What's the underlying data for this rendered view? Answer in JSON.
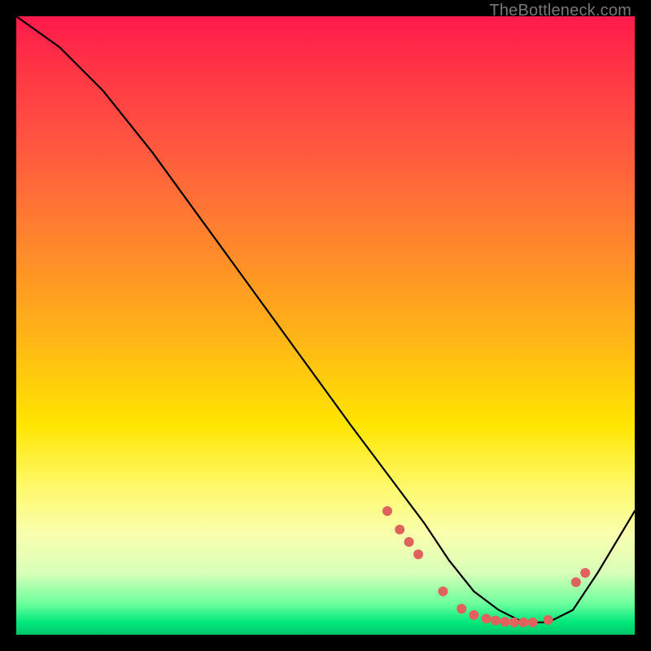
{
  "watermark": "TheBottleneck.com",
  "chart_data": {
    "type": "line",
    "title": "",
    "xlabel": "",
    "ylabel": "",
    "xlim": [
      0,
      100
    ],
    "ylim": [
      0,
      100
    ],
    "series": [
      {
        "name": "curve",
        "x": [
          0,
          7,
          14,
          22,
          30,
          38,
          46,
          54,
          60,
          66,
          70,
          74,
          78,
          82,
          86,
          90,
          94,
          100
        ],
        "y": [
          100,
          95,
          88,
          78,
          67,
          56,
          45,
          34,
          26,
          18,
          12,
          7,
          4,
          2,
          2,
          4,
          10,
          20
        ]
      }
    ],
    "markers": {
      "name": "samples",
      "color": "#e0625c",
      "x": [
        60,
        62,
        63.5,
        65,
        69,
        72,
        74,
        76,
        77.5,
        79,
        80.5,
        82,
        83.5,
        86,
        90.5,
        92
      ],
      "y": [
        20,
        17,
        15,
        13,
        7,
        4.2,
        3.2,
        2.6,
        2.3,
        2.1,
        2.0,
        2.0,
        2.0,
        2.4,
        8.5,
        10
      ]
    }
  }
}
